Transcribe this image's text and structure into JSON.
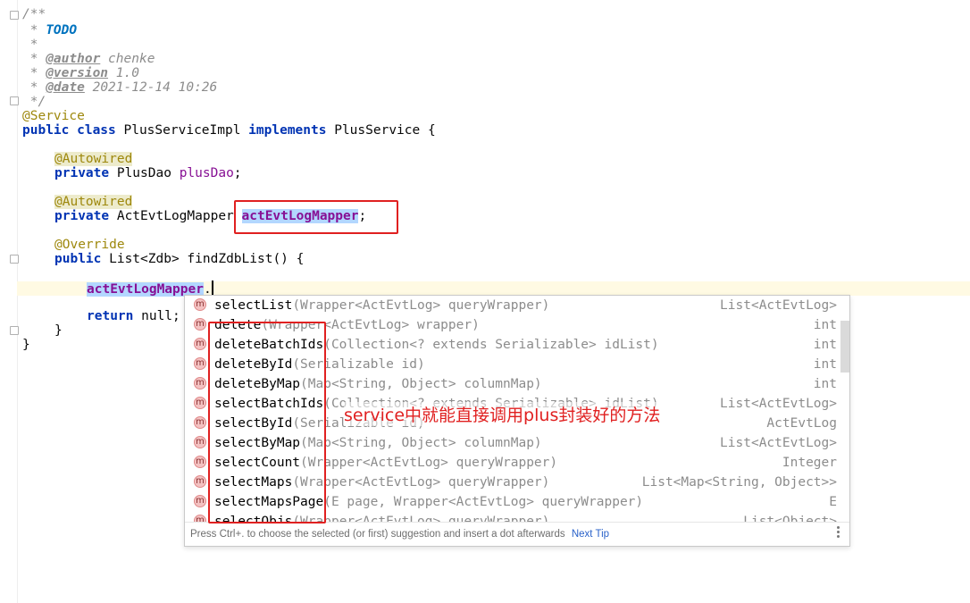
{
  "code": {
    "l1": "/**",
    "l2_star": " * ",
    "l2_todo": "TODO",
    "l3": " *",
    "l4_star": " * ",
    "l4_tag": "@author",
    "l4_val": " chenke",
    "l5_star": " * ",
    "l5_tag": "@version",
    "l5_val": " 1.0",
    "l6_star": " * ",
    "l6_tag": "@date",
    "l6_val": " 2021-12-14 10:26",
    "l7": " */",
    "service_ann": "@Service",
    "class_kw1": "public class",
    "class_name": " PlusServiceImpl ",
    "class_kw2": "implements",
    "class_rest": " PlusService {",
    "autowired1": "@Autowired",
    "f1_kw": "private",
    "f1_type": " PlusDao ",
    "f1_name": "plusDao",
    "f1_end": ";",
    "autowired2": "@Autowired",
    "f2_kw": "private",
    "f2_type": " ActEvtLogMapper ",
    "f2_name": "actEvtLogMapper",
    "f2_end": ";",
    "override": "@Override",
    "m_kw": "public",
    "m_rest": " List<Zdb> findZdbList() {",
    "cur_field": "actEvtLogMapper",
    "cur_dot": ".",
    "ret_kw": "return",
    "ret_null": " null;",
    "close1": "}",
    "close2": "}"
  },
  "completion": {
    "items": [
      {
        "name": "selectList",
        "params": "(Wrapper<ActEvtLog> queryWrapper)",
        "ret": "List<ActEvtLog>"
      },
      {
        "name": "delete",
        "params": "(Wrapper<ActEvtLog> wrapper)",
        "ret": "int"
      },
      {
        "name": "deleteBatchIds",
        "params": "(Collection<? extends Serializable> idList)",
        "ret": "int"
      },
      {
        "name": "deleteById",
        "params": "(Serializable id)",
        "ret": "int"
      },
      {
        "name": "deleteByMap",
        "params": "(Map<String, Object> columnMap)",
        "ret": "int"
      },
      {
        "name": "selectBatchIds",
        "params": "(Collection<? extends Serializable> idList)",
        "ret": "List<ActEvtLog>"
      },
      {
        "name": "selectById",
        "params": "(Serializable id)",
        "ret": "ActEvtLog"
      },
      {
        "name": "selectByMap",
        "params": "(Map<String, Object> columnMap)",
        "ret": "List<ActEvtLog>"
      },
      {
        "name": "selectCount",
        "params": "(Wrapper<ActEvtLog> queryWrapper)",
        "ret": "Integer"
      },
      {
        "name": "selectMaps",
        "params": "(Wrapper<ActEvtLog> queryWrapper)",
        "ret": "List<Map<String, Object>>"
      },
      {
        "name": "selectMapsPage",
        "params": "(E page, Wrapper<ActEvtLog> queryWrapper)",
        "ret": "E"
      },
      {
        "name": "selectObjs",
        "params": "(Wrapper<ActEvtLog> queryWrapper)",
        "ret": "List<Object>"
      }
    ],
    "footer_text": "Press Ctrl+. to choose the selected (or first) suggestion and insert a dot afterwards",
    "footer_tip": "Next Tip"
  },
  "annotation_text": "service中就能直接调用plus封装好的方法",
  "colors": {
    "annotation_red": "#e02020",
    "keyword": "#0033b3",
    "field": "#871094",
    "annotation": "#9e880d"
  }
}
